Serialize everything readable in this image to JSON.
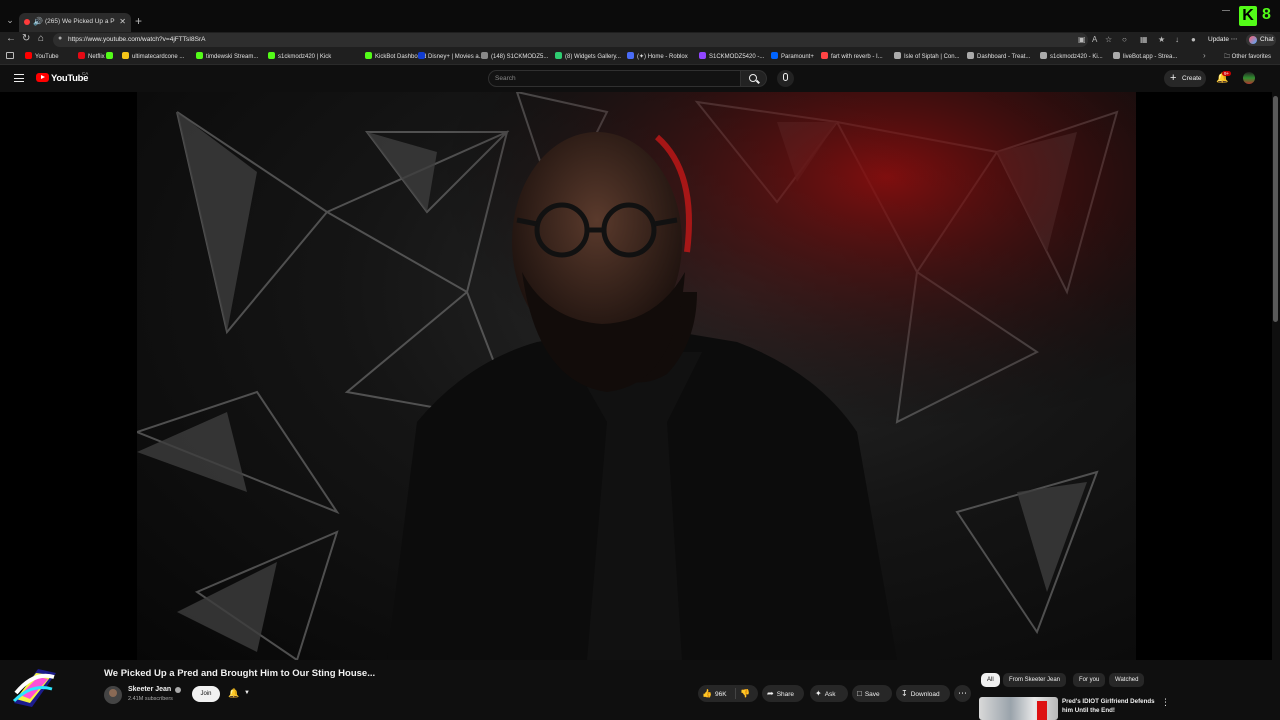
{
  "browser": {
    "tab_title": "(265) We Picked Up a Pred a...",
    "url": "https://www.youtube.com/watch?v=4jFTTsI8SrA",
    "update_label": "Update",
    "chat_label": "Chat",
    "bookmarks": [
      {
        "label": "YouTube",
        "color": "#ff0000"
      },
      {
        "label": "Netflix",
        "color": "#e50914"
      },
      {
        "label": "",
        "color": "#53fc18"
      },
      {
        "label": "ultimatecardcone ...",
        "color": "#f5c518"
      },
      {
        "label": "timdewski Stream...",
        "color": "#53fc18"
      },
      {
        "label": "s1ckmodz420 | Kick",
        "color": "#53fc18"
      },
      {
        "label": "KickBot Dashboard",
        "color": "#53fc18"
      },
      {
        "label": "Disney+ | Movies a...",
        "color": "#113ccf"
      },
      {
        "label": "(148) S1CKMODZ5...",
        "color": "#888888"
      },
      {
        "label": "(8) Widgets Gallery...",
        "color": "#2ecc71"
      },
      {
        "label": "(✦) Home - Roblox",
        "color": "#4a6cf7"
      },
      {
        "label": "S1CKMODZ5420 -...",
        "color": "#9146ff"
      },
      {
        "label": "Paramount+",
        "color": "#0064ff"
      },
      {
        "label": "fart with reverb - I...",
        "color": "#ff4444"
      },
      {
        "label": "Isle of Siptah | Con...",
        "color": "#aaaaaa"
      },
      {
        "label": "Dashboard - Treat...",
        "color": "#aaaaaa"
      },
      {
        "label": "s1ckmodz420 - Ki...",
        "color": "#aaaaaa"
      },
      {
        "label": "liveBot.app - Strea...",
        "color": "#aaaaaa"
      }
    ],
    "other_favorites": "Other favorites"
  },
  "masthead": {
    "logo_text": "YouTube",
    "country_code": "CA",
    "search_placeholder": "Search",
    "create_label": "Create",
    "notification_count": "9+"
  },
  "video": {
    "title": "We Picked Up a Pred and Brought Him to Our Sting House...",
    "channel_name": "Skeeter Jean",
    "subscribers": "2.41M subscribers",
    "join_label": "Join",
    "like_count": "96K",
    "share_label": "Share",
    "ask_label": "Ask",
    "save_label": "Save",
    "download_label": "Download"
  },
  "sidebar": {
    "chips": [
      {
        "label": "All",
        "active": true
      },
      {
        "label": "From Skeeter Jean",
        "active": false
      },
      {
        "label": "For you",
        "active": false
      },
      {
        "label": "Watched",
        "active": false
      }
    ],
    "recommended": [
      {
        "title": "Pred's IDIOT Girlfriend Defends him Until the End!"
      }
    ]
  }
}
